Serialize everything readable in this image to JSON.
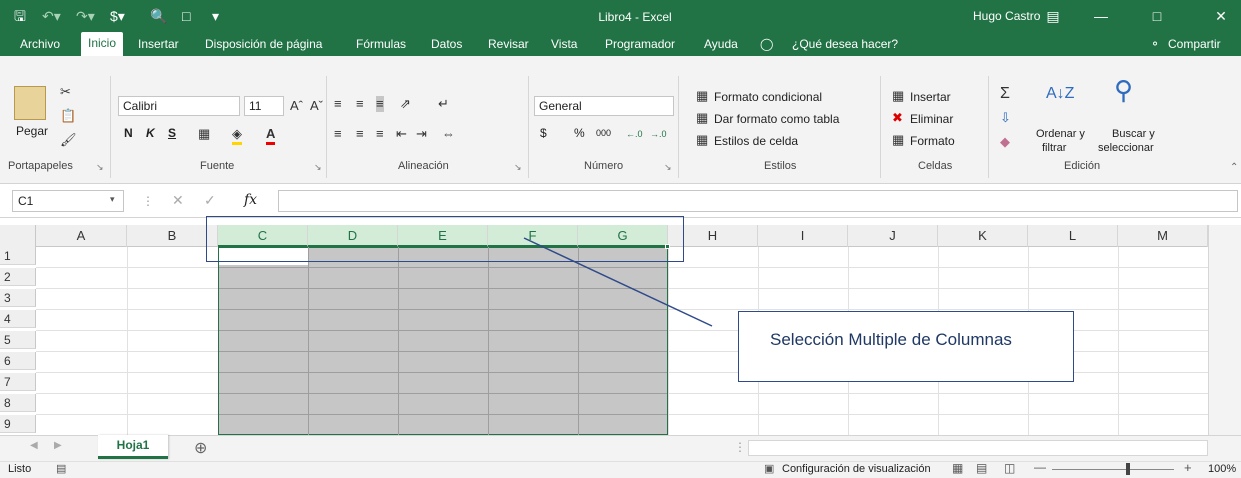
{
  "title_bar": {
    "doc_title": "Libro4  -  Excel",
    "user_name": "Hugo Castro"
  },
  "tabs": [
    "Archivo",
    "Inicio",
    "Insertar",
    "Disposición de página",
    "Fórmulas",
    "Datos",
    "Revisar",
    "Vista",
    "Programador",
    "Ayuda"
  ],
  "tell_me": "¿Qué desea hacer?",
  "share": "Compartir",
  "ribbon": {
    "clipboard": {
      "paste": "Pegar",
      "group": "Portapapeles"
    },
    "font": {
      "name": "Calibri",
      "size": "11",
      "bold": "N",
      "italic": "K",
      "underline": "S",
      "group": "Fuente"
    },
    "alignment": {
      "group": "Alineación"
    },
    "number": {
      "format": "General",
      "currency": "$",
      "percent": "%",
      "thousands": "000",
      "group": "Número"
    },
    "styles": {
      "conditional": "Formato condicional",
      "as_table": "Dar formato como tabla",
      "cell_styles": "Estilos de celda",
      "group": "Estilos"
    },
    "cells": {
      "insert": "Insertar",
      "delete": "Eliminar",
      "format": "Formato",
      "group": "Celdas"
    },
    "editing": {
      "sort": "Ordenar y",
      "sort2": "filtrar",
      "find": "Buscar y",
      "find2": "seleccionar",
      "group": "Edición"
    }
  },
  "formula_bar": {
    "name_box": "C1",
    "fx": "fx",
    "value": ""
  },
  "grid": {
    "columns": [
      "A",
      "B",
      "C",
      "D",
      "E",
      "F",
      "G",
      "H",
      "I",
      "J",
      "K",
      "L",
      "M"
    ],
    "selected_columns": [
      "C",
      "D",
      "E",
      "F",
      "G"
    ],
    "rows": [
      "1",
      "2",
      "3",
      "4",
      "5",
      "6",
      "7",
      "8",
      "9"
    ],
    "active_cell": "C1"
  },
  "annotation": {
    "text": "Selección Multiple de Columnas"
  },
  "sheets": {
    "active": "Hoja1"
  },
  "status": {
    "ready": "Listo",
    "display_settings": "Configuración de visualización",
    "zoom": "100%"
  }
}
